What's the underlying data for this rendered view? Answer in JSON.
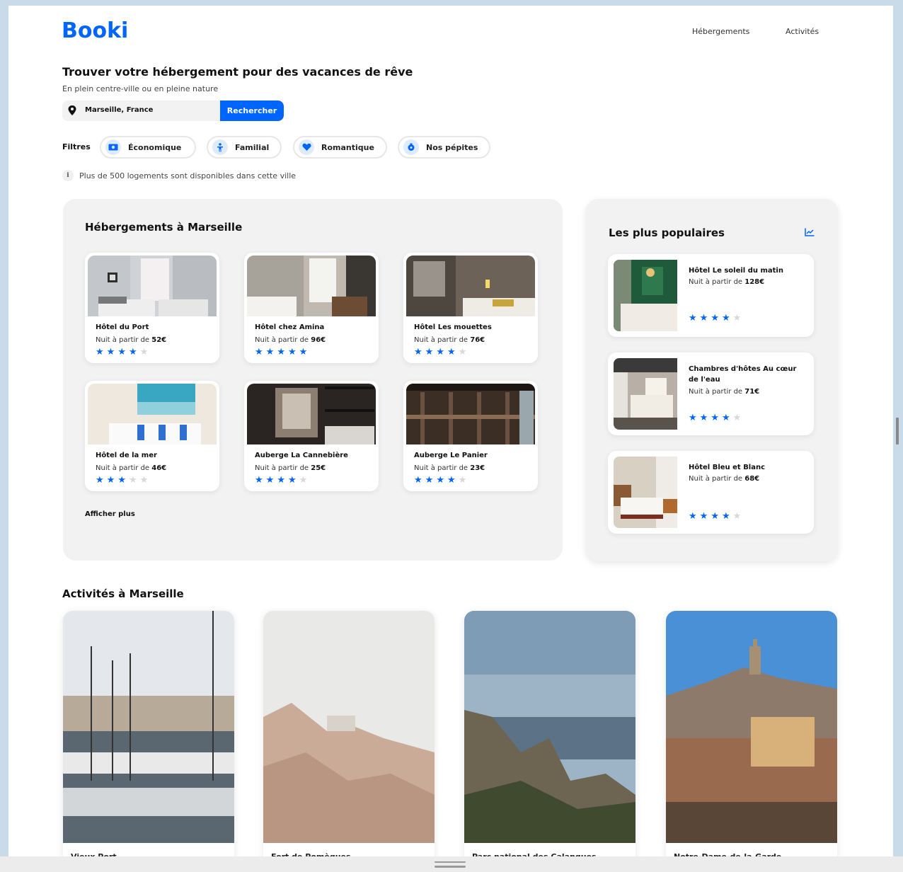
{
  "header": {
    "logo": "Booki",
    "nav": [
      "Hébergements",
      "Activités"
    ]
  },
  "hero": {
    "title": "Trouver votre hébergement pour des vacances de rêve",
    "subtitle": "En plein centre-ville ou en pleine nature",
    "search_value": "Marseille, France",
    "search_button": "Rechercher"
  },
  "filters": {
    "label": "Filtres",
    "chips": [
      "Économique",
      "Familial",
      "Romantique",
      "Nos pépites"
    ]
  },
  "info": {
    "icon_glyph": "i",
    "text": "Plus de 500 logements sont disponibles dans cette ville"
  },
  "accommodations": {
    "title": "Hébergements à Marseille",
    "price_prefix": "Nuit à partir de ",
    "items": [
      {
        "name": "Hôtel du Port",
        "price": "52€",
        "rating": 4
      },
      {
        "name": "Hôtel chez Amina",
        "price": "96€",
        "rating": 5
      },
      {
        "name": "Hôtel Les mouettes",
        "price": "76€",
        "rating": 4
      },
      {
        "name": "Hôtel de la mer",
        "price": "46€",
        "rating": 3
      },
      {
        "name": "Auberge La Cannebière",
        "price": "25€",
        "rating": 4
      },
      {
        "name": "Auberge Le Panier",
        "price": "23€",
        "rating": 4
      }
    ],
    "show_more": "Afficher plus"
  },
  "popular": {
    "title": "Les plus populaires",
    "items": [
      {
        "name": "Hôtel Le soleil du matin",
        "price": "128€",
        "rating": 4
      },
      {
        "name": "Chambres d'hôtes Au cœur de l'eau",
        "price": "71€",
        "rating": 4
      },
      {
        "name": "Hôtel Bleu et Blanc",
        "price": "68€",
        "rating": 4
      }
    ]
  },
  "activities": {
    "title": "Activités à Marseille",
    "items": [
      "Vieux Port",
      "Fort de Pomègues",
      "Parc national des Calanques",
      "Notre-Dame-de-la-Garde"
    ]
  },
  "colors": {
    "brand": "#0065fc",
    "panel": "#f2f2f2",
    "chip_icon_bg": "#deebff",
    "star_off": "#d8d8d8"
  },
  "icons": [
    "map-pin-icon",
    "money-icon",
    "person-icon",
    "heart-icon",
    "gem-icon",
    "info-icon",
    "trend-chart-icon",
    "star-icon"
  ]
}
